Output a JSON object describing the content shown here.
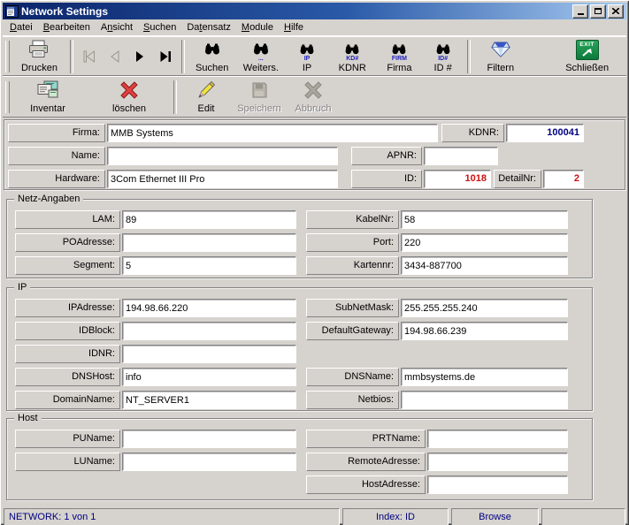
{
  "window": {
    "title": "Network Settings"
  },
  "colors": {
    "titlebar_gradient_start": "#0a246a",
    "titlebar_gradient_end": "#a6caf0",
    "chrome_gray": "#d6d3ce",
    "value_navy": "#000080",
    "value_red": "#cc1111",
    "status_text_navy": "#000080"
  },
  "menu": {
    "items": [
      {
        "pre": "",
        "u": "D",
        "post": "atei"
      },
      {
        "pre": "",
        "u": "B",
        "post": "earbeiten"
      },
      {
        "pre": "A",
        "u": "n",
        "post": "sicht"
      },
      {
        "pre": "",
        "u": "S",
        "post": "uchen"
      },
      {
        "pre": "Da",
        "u": "t",
        "post": "ensatz"
      },
      {
        "pre": "",
        "u": "M",
        "post": "odule"
      },
      {
        "pre": "",
        "u": "H",
        "post": "ilfe"
      }
    ]
  },
  "toolbar_main": {
    "drucken": "Drucken",
    "suchen": "Suchen",
    "weiters": "Weiters.",
    "ip": "IP",
    "kdnr": "KDNR",
    "firma": "Firma",
    "id": "ID #",
    "filtern": "Filtern",
    "schliessen": "Schließen",
    "sub": {
      "weiters": "...",
      "ip": "IP",
      "kdnr": "KD#",
      "firma": "FIRM",
      "id": "ID#"
    },
    "exit_text": "EXIT"
  },
  "toolbar_edit": {
    "inventar": "Inventar",
    "loeschen": "löschen",
    "edit": "Edit",
    "speichern": "Speichern",
    "abbruch": "Abbruch"
  },
  "form": {
    "firma": {
      "label": "Firma:",
      "value": "MMB Systems"
    },
    "kdnr": {
      "label": "KDNR:",
      "value": "100041"
    },
    "name": {
      "label": "Name:",
      "value": ""
    },
    "apnr": {
      "label": "APNR:",
      "value": ""
    },
    "hardware": {
      "label": "Hardware:",
      "value": "3Com Ethernet III Pro"
    },
    "id": {
      "label": "ID:",
      "value": "1018"
    },
    "detailnr": {
      "label": "DetailNr:",
      "value": "2"
    }
  },
  "groups": {
    "netz": {
      "legend": "Netz-Angaben",
      "left": [
        {
          "label": "LAM:",
          "value": "89"
        },
        {
          "label": "POAdresse:",
          "value": ""
        },
        {
          "label": "Segment:",
          "value": "5"
        }
      ],
      "right": [
        {
          "label": "KabelNr:",
          "value": "58"
        },
        {
          "label": "Port:",
          "value": "220"
        },
        {
          "label": "Kartennr:",
          "value": "3434-887700"
        }
      ]
    },
    "ip": {
      "legend": "IP",
      "left": [
        {
          "label": "IPAdresse:",
          "value": "194.98.66.220"
        },
        {
          "label": "IDBlock:",
          "value": ""
        },
        {
          "label": "IDNR:",
          "value": ""
        },
        {
          "label": "DNSHost:",
          "value": "info"
        },
        {
          "label": "DomainName:",
          "value": "NT_SERVER1"
        }
      ],
      "right": [
        {
          "label": "SubNetMask:",
          "value": "255.255.255.240"
        },
        {
          "label": "DefaultGateway:",
          "value": "194.98.66.239"
        },
        {
          "label": "DNSName:",
          "value": "mmbsystems.de"
        },
        {
          "label": "Netbios:",
          "value": ""
        }
      ]
    },
    "host": {
      "legend": "Host",
      "left": [
        {
          "label": "PUName:",
          "value": ""
        },
        {
          "label": "LUName:",
          "value": ""
        }
      ],
      "right": [
        {
          "label": "PRTName:",
          "value": ""
        },
        {
          "label": "RemoteAdresse:",
          "value": ""
        },
        {
          "label": "HostAdresse:",
          "value": ""
        }
      ]
    }
  },
  "statusbar": {
    "record": "NETWORK: 1 von 1",
    "index": "Index: ID",
    "mode": "Browse"
  }
}
